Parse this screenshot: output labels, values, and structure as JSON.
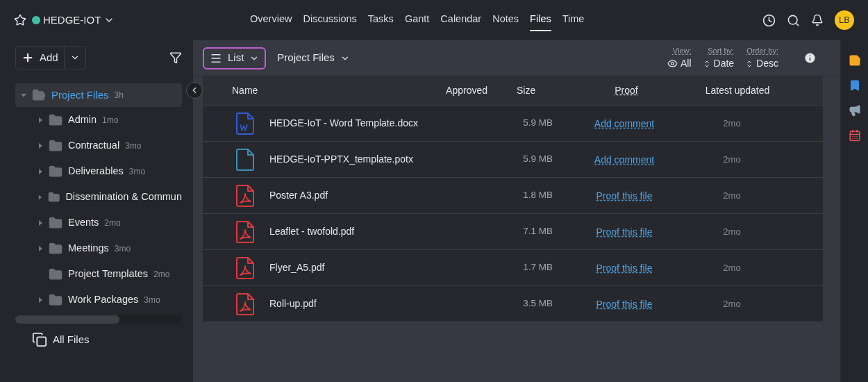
{
  "project": {
    "name": "HEDGE-IOT",
    "color": "#3fbfa5"
  },
  "nav": [
    {
      "label": "Overview",
      "selected": false
    },
    {
      "label": "Discussions",
      "selected": false
    },
    {
      "label": "Tasks",
      "selected": false
    },
    {
      "label": "Gantt",
      "selected": false
    },
    {
      "label": "Calendar",
      "selected": false
    },
    {
      "label": "Notes",
      "selected": false
    },
    {
      "label": "Files",
      "selected": true
    },
    {
      "label": "Time",
      "selected": false
    }
  ],
  "avatar": "LB",
  "sidebar": {
    "add": "Add",
    "tree": {
      "label": "Project Files",
      "time": "3h",
      "expanded": true,
      "selected": true,
      "children": [
        {
          "label": "Admin",
          "time": "1mo",
          "expandable": true
        },
        {
          "label": "Contractual",
          "time": "3mo",
          "expandable": true
        },
        {
          "label": "Deliverables",
          "time": "3mo",
          "expandable": true
        },
        {
          "label": "Dissemination & Commun",
          "expandable": true
        },
        {
          "label": "Events",
          "time": "2mo",
          "expandable": true
        },
        {
          "label": "Meetings",
          "time": "3mo",
          "expandable": true
        },
        {
          "label": "Project Templates",
          "time": "2mo",
          "expandable": false
        },
        {
          "label": "Work Packages",
          "time": "3mo",
          "expandable": true
        }
      ]
    },
    "all_files": "All Files"
  },
  "toolbar": {
    "layout": "List",
    "folder": "Project Files",
    "view": {
      "label": "View:",
      "value": "All"
    },
    "sort": {
      "label": "Sort by:",
      "value": "Date"
    },
    "order": {
      "label": "Order by:",
      "value": "Desc"
    }
  },
  "table": {
    "columns": [
      "Name",
      "Approved",
      "Size",
      "Proof",
      "Latest updated"
    ],
    "rows": [
      {
        "kind": "word",
        "name": "HEDGE-IoT - Word Template.docx",
        "size": "5.9 MB",
        "proof": "Add comment",
        "updated": "2mo"
      },
      {
        "kind": "blank",
        "name": "HEDGE-IoT-PPTX_template.potx",
        "size": "5.9 MB",
        "proof": "Add comment",
        "updated": "2mo"
      },
      {
        "kind": "pdf",
        "name": "Poster A3.pdf",
        "size": "1.8 MB",
        "proof": "Proof this file",
        "updated": "2mo"
      },
      {
        "kind": "pdf",
        "name": "Leaflet - twofold.pdf",
        "size": "7.1 MB",
        "proof": "Proof this file",
        "updated": "2mo"
      },
      {
        "kind": "pdf",
        "name": "Flyer_A5.pdf",
        "size": "1.7 MB",
        "proof": "Proof this file",
        "updated": "2mo"
      },
      {
        "kind": "pdf",
        "name": "Roll-up.pdf",
        "size": "3.5 MB",
        "proof": "Proof this file",
        "updated": "2mo"
      }
    ]
  }
}
